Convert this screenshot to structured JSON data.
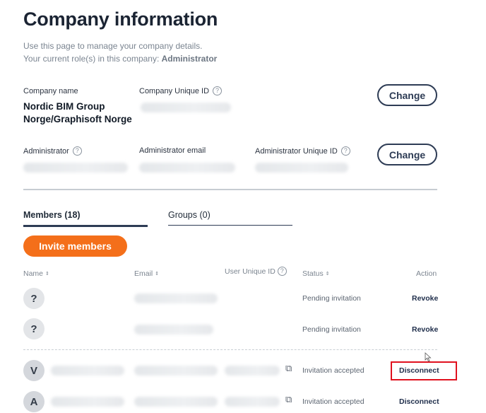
{
  "header": {
    "title": "Company information",
    "intro_line1": "Use this page to manage your company details.",
    "intro_line2_prefix": "Your current role(s) in this company: ",
    "intro_role": "Administrator"
  },
  "company": {
    "name_label": "Company name",
    "name_value": "Nordic BIM Group Norge/Graphisoft Norge",
    "unique_id_label": "Company Unique ID",
    "change_label": "Change"
  },
  "admin": {
    "administrator_label": "Administrator",
    "email_label": "Administrator email",
    "unique_id_label": "Administrator Unique ID",
    "change_label": "Change"
  },
  "tabs": [
    {
      "label": "Members (18)",
      "active": true
    },
    {
      "label": "Groups (0)",
      "active": false
    }
  ],
  "invite_label": "Invite members",
  "table": {
    "columns": {
      "name": "Name",
      "email": "Email",
      "user_id": "User Unique ID",
      "status": "Status",
      "action": "Action"
    },
    "sort_glyph": "⇕",
    "rows": [
      {
        "initial": "?",
        "status": "Pending invitation",
        "action": "Revoke"
      },
      {
        "initial": "?",
        "status": "Pending invitation",
        "action": "Revoke"
      },
      {
        "initial": "V",
        "status": "Invitation accepted",
        "action": "Disconnect"
      },
      {
        "initial": "A",
        "status": "Invitation accepted",
        "action": "Disconnect"
      }
    ]
  },
  "colors": {
    "accent_orange": "#f46f1a",
    "navy": "#2e3c55",
    "highlight_red": "#e0111f"
  },
  "icons": {
    "help": "question-circle-icon",
    "copy": "copy-icon",
    "sort": "sort-icon"
  }
}
